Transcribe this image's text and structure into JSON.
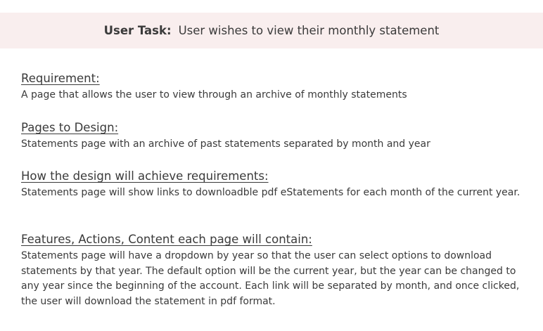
{
  "task": {
    "label": "User Task:",
    "text": "User wishes to view their monthly statement"
  },
  "sections": [
    {
      "heading": "Requirement:",
      "body": "A page that allows the user to view through an archive of monthly statements"
    },
    {
      "heading": "Pages to Design:",
      "body": "Statements page with an archive of past statements separated by month and year"
    },
    {
      "heading": "How the design will achieve requirements:",
      "body": "Statements page will show links to downloadble pdf eStatements for each month of the current year."
    },
    {
      "heading": "Features, Actions, Content each page will contain:",
      "body": "Statements page will have a dropdown by year so that the user can select options to download statements by that year.  The default option will be the current year, but the year can be changed to any year since the beginning of the account.  Each link will be separated by month, and once clicked, the user will download the statement in pdf format."
    }
  ],
  "colors": {
    "banner_background": "#f9eeee",
    "text": "#3a3a3a"
  }
}
